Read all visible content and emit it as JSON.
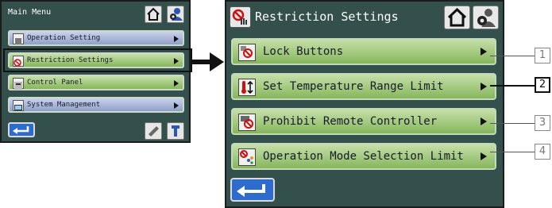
{
  "small_menu": {
    "title": "Main Menu",
    "items": [
      {
        "label": "Operation Setting",
        "icon": "operation-setting-icon"
      },
      {
        "label": "Restriction Settings",
        "icon": "restriction-icon"
      },
      {
        "label": "Control Panel",
        "icon": "control-panel-icon"
      },
      {
        "label": "System Management",
        "icon": "system-management-icon"
      }
    ],
    "selected_index": 1
  },
  "restriction_menu": {
    "title": "Restriction Settings",
    "items": [
      {
        "label": "Lock Buttons",
        "icon": "lock-buttons-icon",
        "callout": "1"
      },
      {
        "label": "Set Temperature Range Limit",
        "icon": "thermometer-icon",
        "callout": "2"
      },
      {
        "label": "Prohibit Remote Controller",
        "icon": "prohibit-remote-icon",
        "callout": "3"
      },
      {
        "label": "Operation Mode Selection Limit",
        "icon": "mode-limit-icon",
        "callout": "4"
      }
    ],
    "highlighted_callout": "2"
  },
  "colors": {
    "panel_bg": "#33504c",
    "item_green": "#86b65c",
    "item_blue": "#8fa0c9",
    "back_button": "#2d6bcc"
  }
}
